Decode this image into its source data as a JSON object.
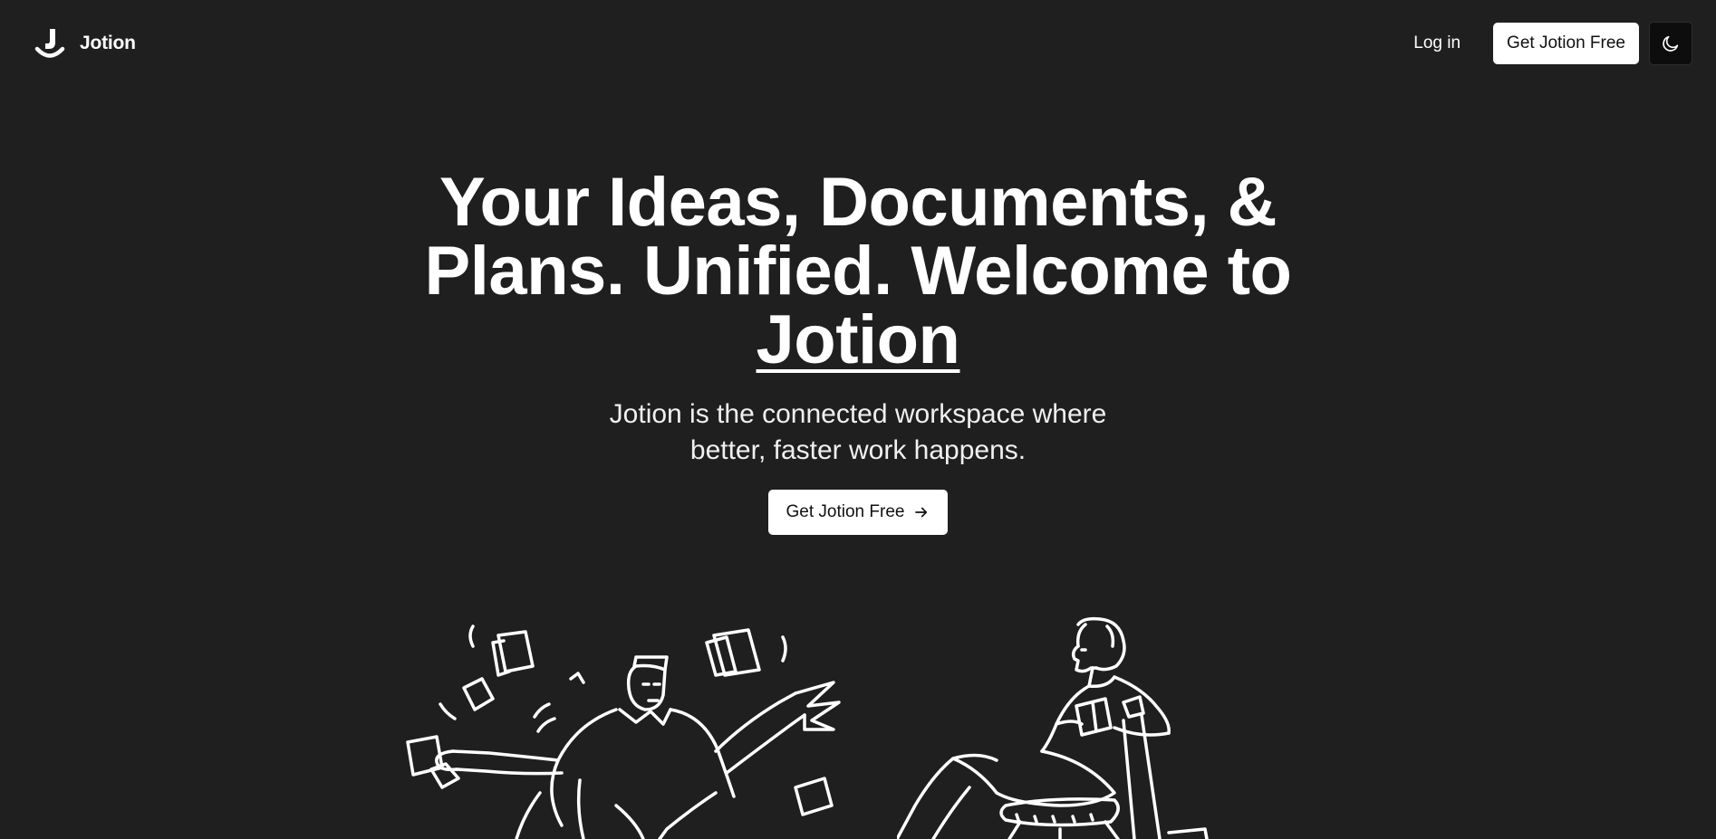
{
  "nav": {
    "brand_name": "Jotion",
    "login_label": "Log in",
    "cta_label": "Get Jotion Free",
    "theme_icon": "moon-icon"
  },
  "hero": {
    "headline_text": "Your Ideas, Documents, & Plans. Unified. Welcome to ",
    "headline_brand": "Jotion",
    "subheadline": "Jotion is the connected workspace where better, faster work happens.",
    "cta_label": "Get Jotion Free",
    "cta_icon": "arrow-right-icon"
  },
  "illustrations": [
    {
      "name": "man-juggling-papers-illustration"
    },
    {
      "name": "woman-reading-illustration"
    }
  ],
  "colors": {
    "background": "#1f1f1f",
    "text": "#ffffff",
    "button_bg": "#ffffff",
    "button_text": "#111111",
    "toggle_bg": "#0d0d0d"
  }
}
